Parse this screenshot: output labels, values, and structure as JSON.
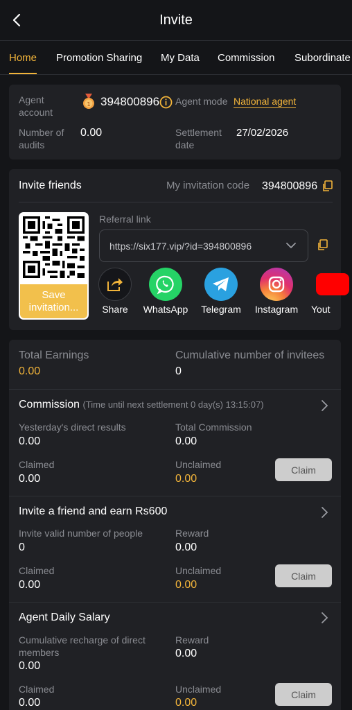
{
  "header": {
    "title": "Invite"
  },
  "tabs": [
    "Home",
    "Promotion Sharing",
    "My Data",
    "Commission",
    "Subordinate"
  ],
  "agent": {
    "account_label": "Agent account",
    "account_value": "394800896",
    "mode_label": "Agent mode",
    "mode_value": "National agent",
    "audits_label": "Number of audits",
    "audits_value": "0.00",
    "settlement_label": "Settlement date",
    "settlement_value": "27/02/2026"
  },
  "invite": {
    "title": "Invite friends",
    "code_label": "My invitation code",
    "code_value": "394800896",
    "save_label": "Save invitation...",
    "referral_label": "Referral link",
    "referral_url": "https://six177.vip/?id=394800896",
    "share": [
      {
        "label": "Share",
        "icon": "share-icon"
      },
      {
        "label": "WhatsApp",
        "icon": "whatsapp-icon"
      },
      {
        "label": "Telegram",
        "icon": "telegram-icon"
      },
      {
        "label": "Instagram",
        "icon": "instagram-icon"
      },
      {
        "label": "Yout",
        "icon": "youtube-icon"
      }
    ]
  },
  "earnings": {
    "total_label": "Total Earnings",
    "total_value": "0.00",
    "invitees_label": "Cumulative number of invitees",
    "invitees_value": "0"
  },
  "commission": {
    "title": "Commission",
    "subtitle": "(Time until next settlement  0 day(s) 13:15:07)",
    "yesterday_label": "Yesterday's direct results",
    "yesterday_value": "0.00",
    "total_label": "Total Commission",
    "total_value": "0.00",
    "claimed_label": "Claimed",
    "claimed_value": "0.00",
    "unclaimed_label": "Unclaimed",
    "unclaimed_value": "0.00",
    "claim_button": "Claim"
  },
  "invite_earn": {
    "title": "Invite a friend and earn Rs600",
    "valid_label": "Invite valid number of people",
    "valid_value": "0",
    "reward_label": "Reward",
    "reward_value": "0.00",
    "claimed_label": "Claimed",
    "claimed_value": "0.00",
    "unclaimed_label": "Unclaimed",
    "unclaimed_value": "0.00",
    "claim_button": "Claim"
  },
  "salary": {
    "title": "Agent Daily Salary",
    "recharge_label": "Cumulative recharge of direct members",
    "recharge_value": "0.00",
    "reward_label": "Reward",
    "reward_value": "0.00",
    "claimed_label": "Claimed",
    "claimed_value": "0.00",
    "unclaimed_label": "Unclaimed",
    "unclaimed_value": "0.00",
    "claim_button": "Claim"
  },
  "colors": {
    "accent": "#f2b43a",
    "background": "#141518",
    "card": "#202125"
  }
}
